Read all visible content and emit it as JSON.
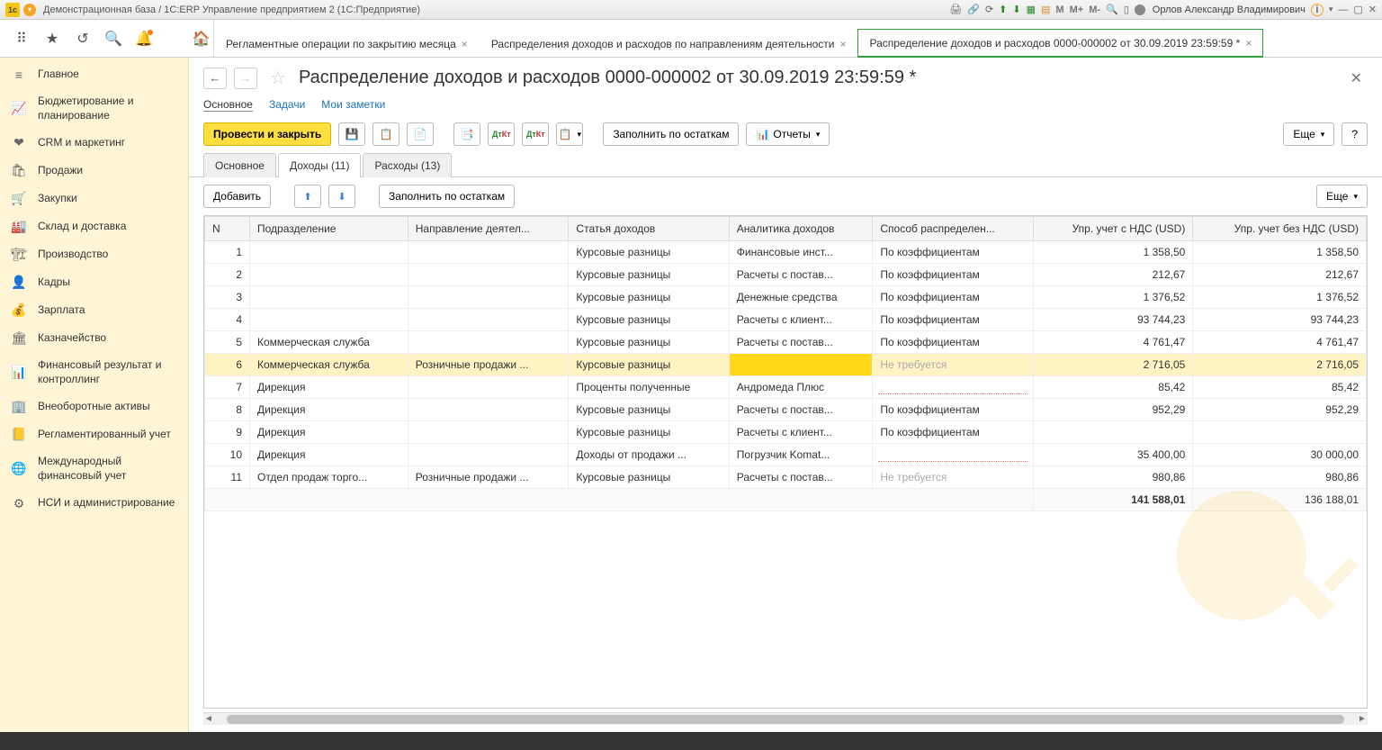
{
  "window": {
    "title": "Демонстрационная база / 1С:ERP Управление предприятием 2  (1С:Предприятие)",
    "user": "Орлов Александр Владимирович",
    "m_labels": [
      "M",
      "M+",
      "M-"
    ]
  },
  "tabs": [
    {
      "label": "Регламентные операции по закрытию месяца",
      "active": false
    },
    {
      "label": "Распределения доходов и расходов по направлениям деятельности",
      "active": false
    },
    {
      "label": "Распределение доходов и расходов  0000-000002 от 30.09.2019 23:59:59 *",
      "active": true
    }
  ],
  "sidebar": [
    {
      "icon": "≡",
      "label": "Главное"
    },
    {
      "icon": "📈",
      "label": "Бюджетирование и планирование"
    },
    {
      "icon": "❤",
      "label": "CRM и маркетинг"
    },
    {
      "icon": "🛍",
      "label": "Продажи"
    },
    {
      "icon": "🛒",
      "label": "Закупки"
    },
    {
      "icon": "🏭",
      "label": "Склад и доставка"
    },
    {
      "icon": "🏗",
      "label": "Производство"
    },
    {
      "icon": "👤",
      "label": "Кадры"
    },
    {
      "icon": "💰",
      "label": "Зарплата"
    },
    {
      "icon": "🏛",
      "label": "Казначейство"
    },
    {
      "icon": "📊",
      "label": "Финансовый результат и контроллинг"
    },
    {
      "icon": "🏢",
      "label": "Внеоборотные активы"
    },
    {
      "icon": "📒",
      "label": "Регламентированный учет"
    },
    {
      "icon": "🌐",
      "label": "Международный финансовый учет"
    },
    {
      "icon": "⚙",
      "label": "НСИ и администрирование"
    }
  ],
  "page": {
    "title": "Распределение доходов и расходов  0000-000002 от 30.09.2019 23:59:59 *",
    "subtabs": [
      {
        "label": "Основное",
        "active": true
      },
      {
        "label": "Задачи",
        "active": false
      },
      {
        "label": "Мои заметки",
        "active": false
      }
    ],
    "actions": {
      "primary": "Провести и закрыть",
      "fill_balance": "Заполнить по остаткам",
      "reports": "Отчеты",
      "more": "Еще",
      "help": "?"
    },
    "inner_tabs": [
      {
        "label": "Основное",
        "active": false
      },
      {
        "label": "Доходы (11)",
        "active": true
      },
      {
        "label": "Расходы (13)",
        "active": false
      }
    ],
    "table_actions": {
      "add": "Добавить",
      "fill_balance": "Заполнить по остаткам",
      "more": "Еще"
    },
    "columns": [
      "N",
      "Подразделение",
      "Направление деятел...",
      "Статья доходов",
      "Аналитика доходов",
      "Способ распределен...",
      "Упр. учет с НДС (USD)",
      "Упр. учет без НДС (USD)"
    ],
    "rows": [
      {
        "n": "1",
        "dept": "",
        "dir": "",
        "item": "Курсовые разницы",
        "anal": "Финансовые инст...",
        "method": "По коэффициентам",
        "nds": "1 358,50",
        "bez": "1 358,50"
      },
      {
        "n": "2",
        "dept": "",
        "dir": "",
        "item": "Курсовые разницы",
        "anal": "Расчеты с постав...",
        "method": "По коэффициентам",
        "nds": "212,67",
        "bez": "212,67"
      },
      {
        "n": "3",
        "dept": "",
        "dir": "",
        "item": "Курсовые разницы",
        "anal": "Денежные средства",
        "method": "По коэффициентам",
        "nds": "1 376,52",
        "bez": "1 376,52"
      },
      {
        "n": "4",
        "dept": "",
        "dir": "",
        "item": "Курсовые разницы",
        "anal": "Расчеты с клиент...",
        "method": "По коэффициентам",
        "nds": "93 744,23",
        "bez": "93 744,23"
      },
      {
        "n": "5",
        "dept": "Коммерческая служба",
        "dir": "",
        "item": "Курсовые разницы",
        "anal": "Расчеты с постав...",
        "method": "По коэффициентам",
        "nds": "4 761,47",
        "bez": "4 761,47"
      },
      {
        "n": "6",
        "dept": "Коммерческая служба",
        "dir": "Розничные продажи ...",
        "item": "Курсовые разницы",
        "anal": "",
        "method": "Не требуется",
        "muted": true,
        "nds": "2 716,05",
        "bez": "2 716,05",
        "selected": true
      },
      {
        "n": "7",
        "dept": "Дирекция",
        "dir": "",
        "item": "Проценты полученные",
        "anal": "Андромеда Плюс",
        "method": "",
        "dotted": true,
        "nds": "85,42",
        "bez": "85,42"
      },
      {
        "n": "8",
        "dept": "Дирекция",
        "dir": "",
        "item": "Курсовые разницы",
        "anal": "Расчеты с постав...",
        "method": "По коэффициентам",
        "nds": "952,29",
        "bez": "952,29"
      },
      {
        "n": "9",
        "dept": "Дирекция",
        "dir": "",
        "item": "Курсовые разницы",
        "anal": "Расчеты с клиент...",
        "method": "По коэффициентам",
        "nds": "",
        "bez": ""
      },
      {
        "n": "10",
        "dept": "Дирекция",
        "dir": "",
        "item": "Доходы от продажи ...",
        "anal": "Погрузчик Komat...",
        "method": "",
        "dotted": true,
        "nds": "35 400,00",
        "bez": "30 000,00"
      },
      {
        "n": "11",
        "dept": "Отдел продаж торго...",
        "dir": "Розничные продажи ...",
        "item": "Курсовые разницы",
        "anal": "Расчеты с постав...",
        "method": "Не требуется",
        "muted": true,
        "nds": "980,86",
        "bez": "980,86"
      }
    ],
    "totals": {
      "nds": "141 588,01",
      "bez": "136 188,01"
    }
  }
}
